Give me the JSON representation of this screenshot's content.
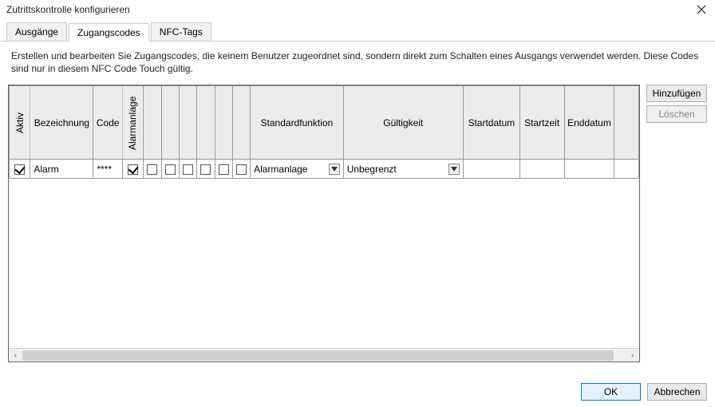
{
  "title": "Zutrittskontrolle konfigurieren",
  "tabs": {
    "ausgaenge": "Ausgänge",
    "zugangscodes": "Zugangscodes",
    "nfctags": "NFC-Tags"
  },
  "description": "Erstellen und bearbeiten Sie Zugangscodes, die keinem Benutzer zugeordnet sind, sondern direkt zum Schalten eines Ausgangs verwendet werden. Diese Codes sind nur in diesem NFC Code Touch gültig.",
  "columns": {
    "aktiv": "Aktiv",
    "bezeichnung": "Bezeichnung",
    "code": "Code",
    "alarmanlage": "Alarmanlage",
    "standardfunktion": "Standardfunktion",
    "gueltigkeit": "Gültigkeit",
    "startdatum": "Startdatum",
    "startzeit": "Startzeit",
    "enddatum": "Enddatum"
  },
  "rows": [
    {
      "aktiv": true,
      "bezeichnung": "Alarm",
      "code": "****",
      "alarmanlage": true,
      "chk1": false,
      "chk2": false,
      "chk3": false,
      "chk4": false,
      "chk5": false,
      "chk6": false,
      "standardfunktion": "Alarmanlage",
      "gueltigkeit": "Unbegrenzt",
      "startdatum": "",
      "startzeit": "",
      "enddatum": ""
    }
  ],
  "buttons": {
    "hinzufuegen": "Hinzufügen",
    "loeschen": "Löschen",
    "ok": "OK",
    "abbrechen": "Abbrechen"
  }
}
